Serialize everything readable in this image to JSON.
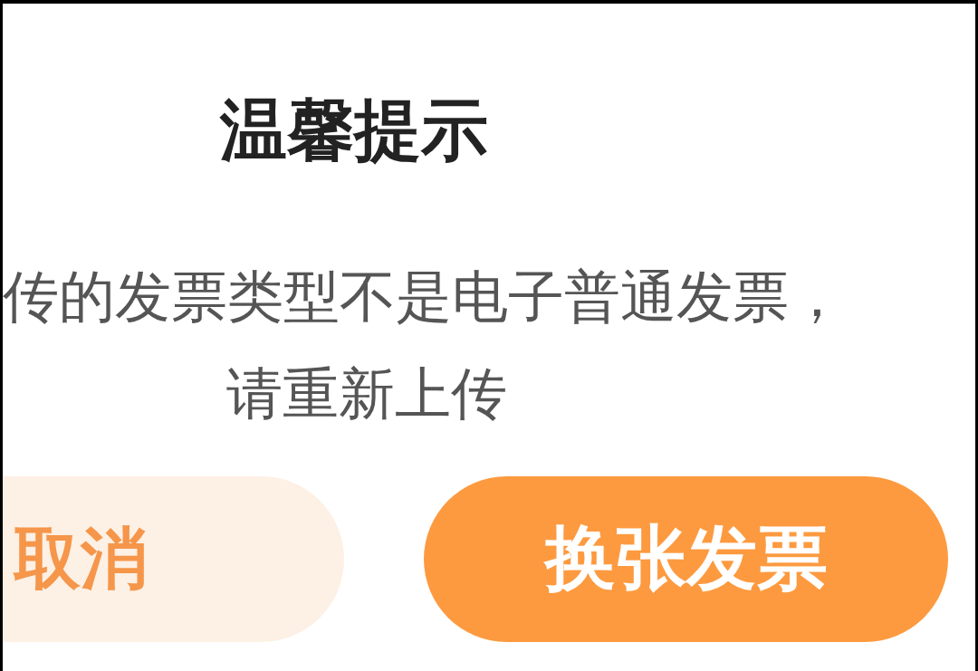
{
  "dialog": {
    "title": "温馨提示",
    "message_lines": [
      "传的发票类型不是电子普通发票，",
      "请重新上传"
    ],
    "buttons": [
      {
        "label": "取消",
        "kind": "secondary"
      },
      {
        "label": "换张发票",
        "kind": "primary"
      }
    ]
  }
}
